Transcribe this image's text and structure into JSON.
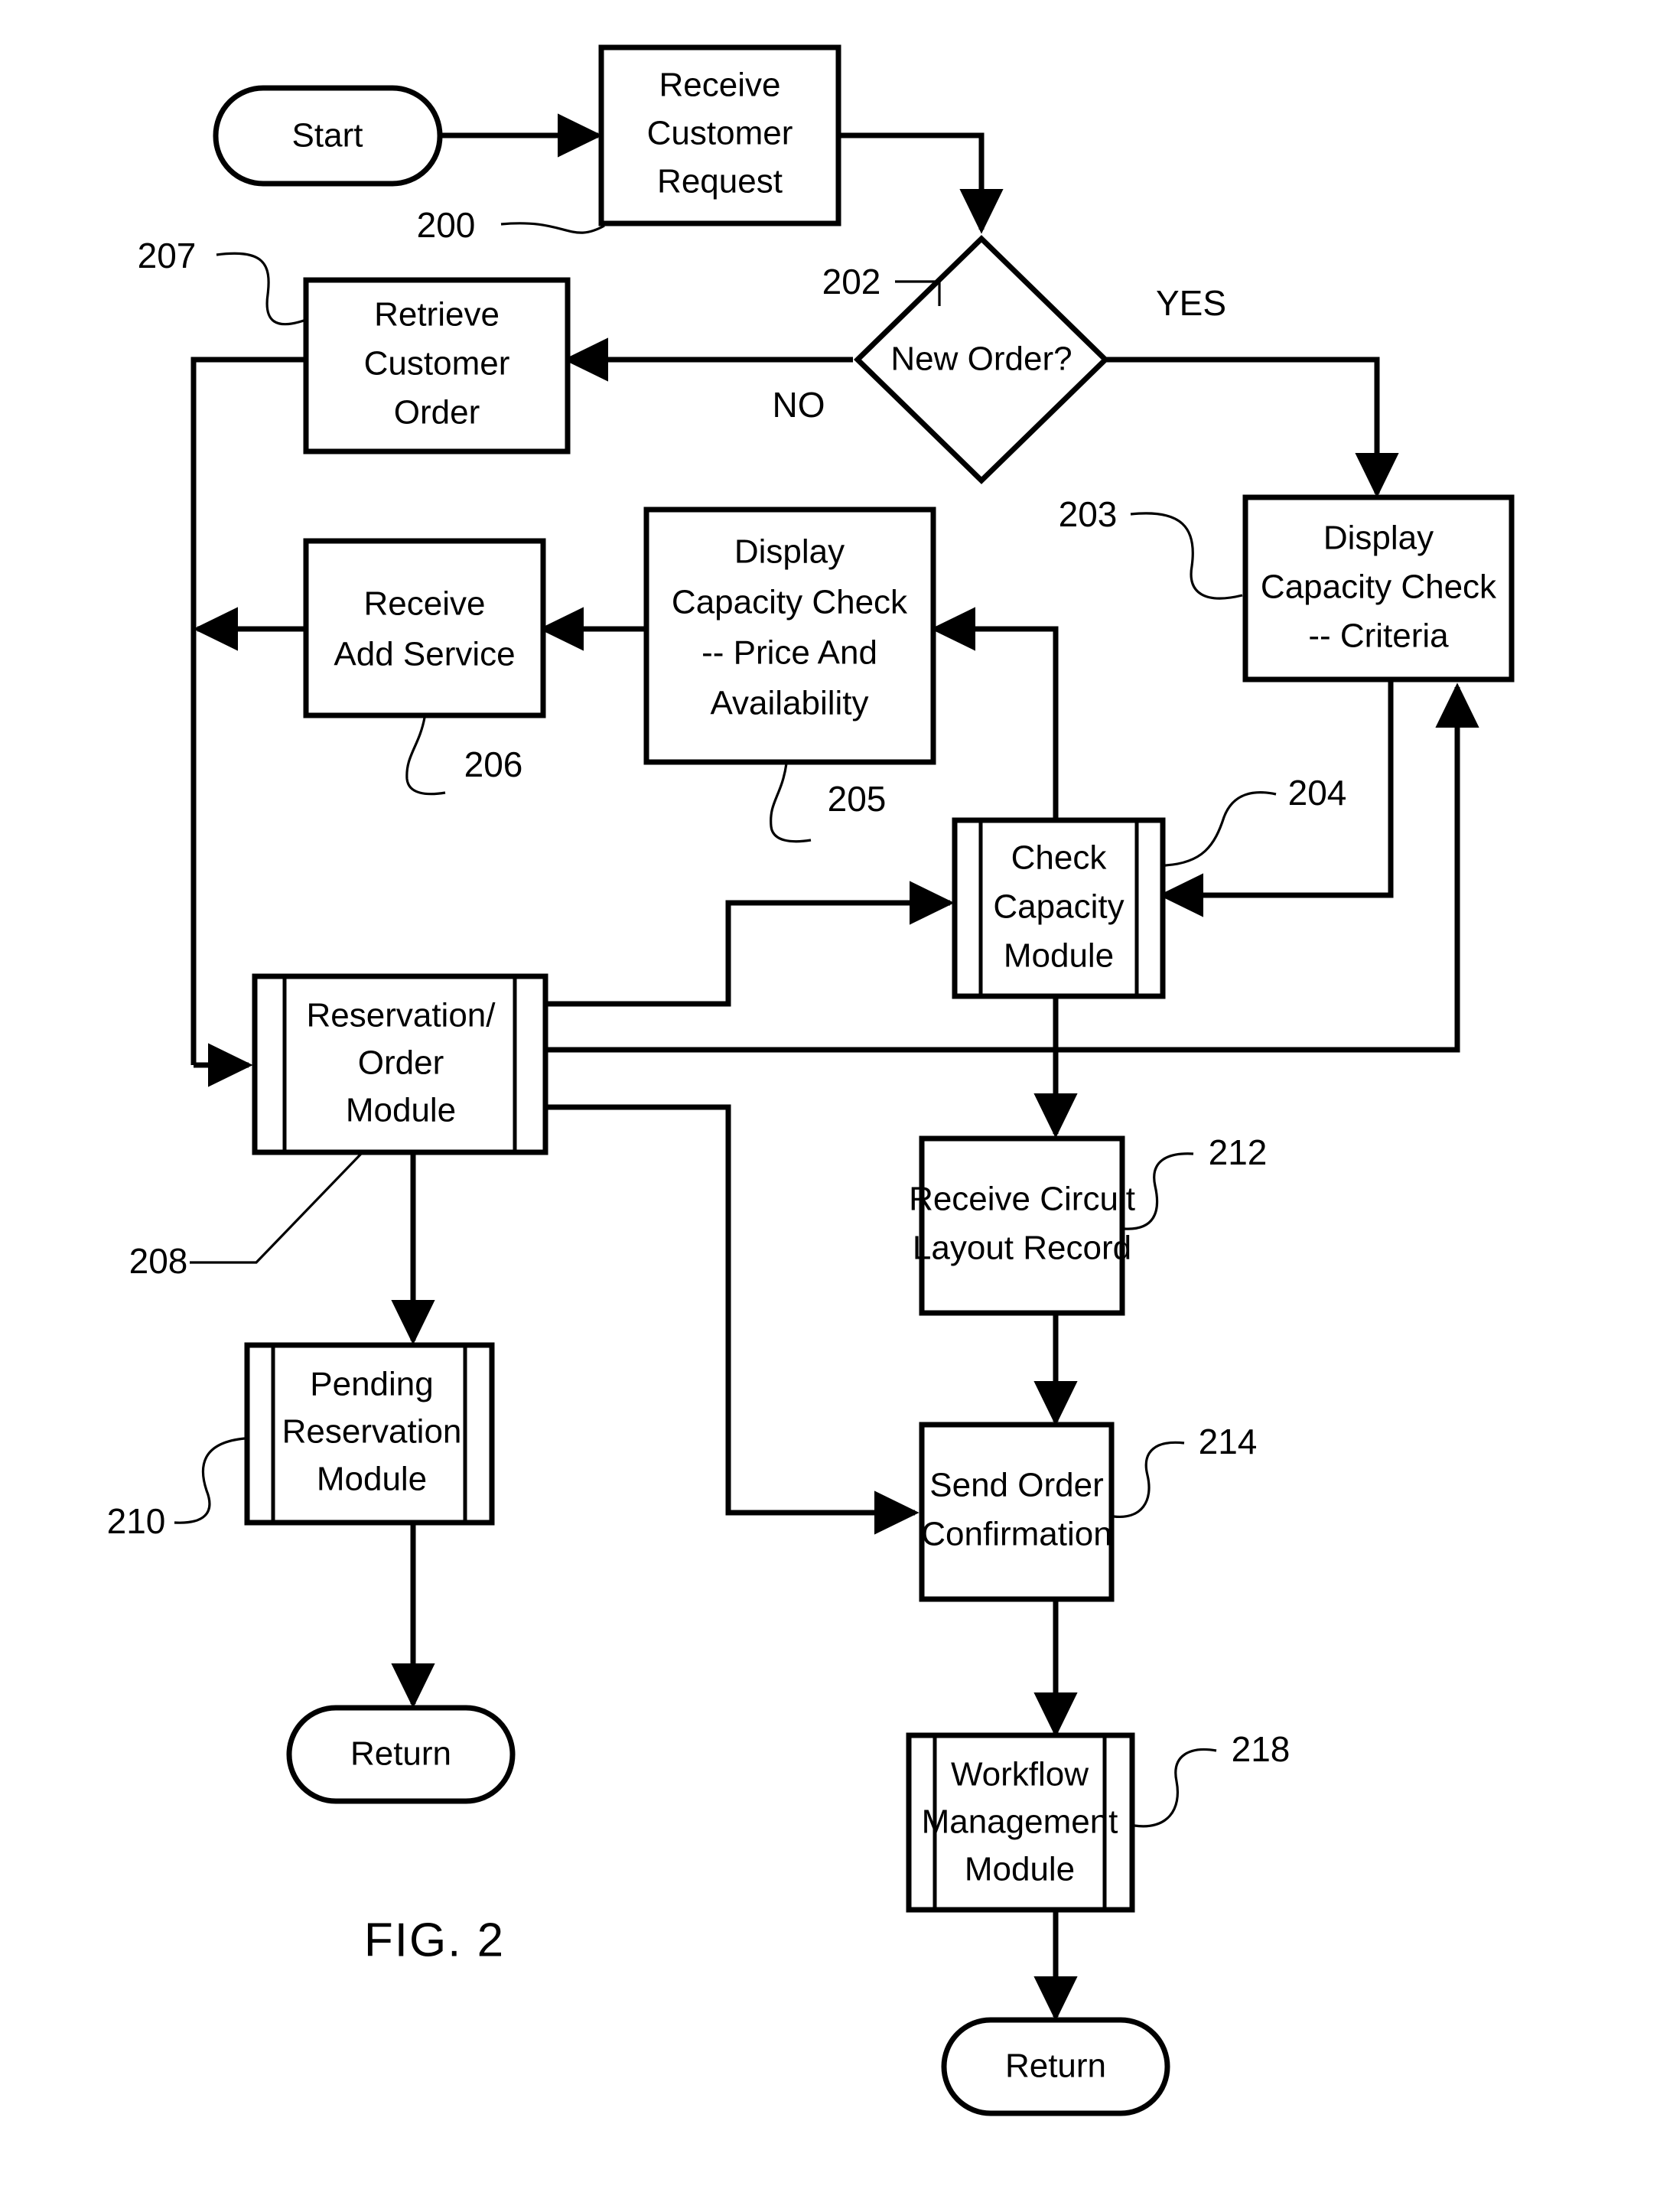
{
  "figure": {
    "caption": "FIG. 2",
    "title": "Order processing flowchart"
  },
  "nodes": {
    "start": {
      "label": "Start",
      "shape": "terminator"
    },
    "receive_customer_request": {
      "line1": "Receive",
      "line2": "Customer",
      "line3": "Request",
      "ref": "200",
      "shape": "process"
    },
    "new_order_decision": {
      "label": "New Order?",
      "ref": "202",
      "shape": "decision",
      "yes_label": "YES",
      "no_label": "NO"
    },
    "retrieve_customer_order": {
      "line1": "Retrieve",
      "line2": "Customer",
      "line3": "Order",
      "ref": "207",
      "shape": "process"
    },
    "display_capacity_criteria": {
      "line1": "Display",
      "line2": "Capacity Check",
      "line3": "-- Criteria",
      "ref": "203",
      "shape": "process"
    },
    "display_capacity_price": {
      "line1": "Display",
      "line2": "Capacity Check",
      "line3": "-- Price And",
      "line4": "Availability",
      "ref": "205",
      "shape": "process"
    },
    "receive_add_service": {
      "line1": "Receive",
      "line2": "Add Service",
      "ref": "206",
      "shape": "process"
    },
    "check_capacity_module": {
      "line1": "Check",
      "line2": "Capacity",
      "line3": "Module",
      "ref": "204",
      "shape": "module"
    },
    "reservation_order_module": {
      "line1": "Reservation/",
      "line2": "Order",
      "line3": "Module",
      "ref": "208",
      "shape": "module"
    },
    "pending_reservation_module": {
      "line1": "Pending",
      "line2": "Reservation",
      "line3": "Module",
      "ref": "210",
      "shape": "module"
    },
    "receive_circuit_layout_record": {
      "line1": "Receive Circuit",
      "line2": "Layout Record",
      "ref": "212",
      "shape": "process"
    },
    "send_order_confirmation": {
      "line1": "Send Order",
      "line2": "Confirmation",
      "ref": "214",
      "shape": "process"
    },
    "workflow_management_module": {
      "line1": "Workflow",
      "line2": "Management",
      "line3": "Module",
      "ref": "218",
      "shape": "module"
    },
    "return_left": {
      "label": "Return",
      "shape": "terminator"
    },
    "return_right": {
      "label": "Return",
      "shape": "terminator"
    }
  },
  "colors": {
    "ink": "#000000",
    "paper": "#ffffff"
  }
}
